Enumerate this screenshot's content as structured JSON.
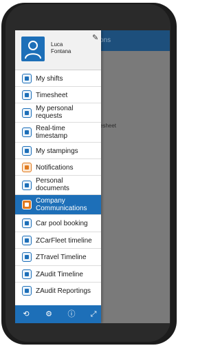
{
  "background_app": {
    "header_text_fragment": "ons",
    "body_text_fragment": "esheet"
  },
  "profile": {
    "first_name": "Luca",
    "last_name": "Fontana",
    "edit_icon": "pencil-icon"
  },
  "menu": {
    "items": [
      {
        "label": "My shifts",
        "icon": "shifts-icon",
        "active": false
      },
      {
        "label": "Timesheet",
        "icon": "gear-icon",
        "active": false
      },
      {
        "label": "My personal requests",
        "icon": "requests-icon",
        "active": false
      },
      {
        "label": "Real-time timestamp",
        "icon": "clock-icon",
        "active": false
      },
      {
        "label": "My stampings",
        "icon": "clock-icon",
        "active": false
      },
      {
        "label": "Notifications",
        "icon": "bell-icon",
        "active": false
      },
      {
        "label": "Personal documents",
        "icon": "document-icon",
        "active": false
      },
      {
        "label": "Company Communications",
        "icon": "communications-icon",
        "active": true
      },
      {
        "label": "Car pool booking",
        "icon": "car-icon",
        "active": false
      },
      {
        "label": "ZCarFleet timeline",
        "icon": "fleet-icon",
        "active": false
      },
      {
        "label": "ZTravel Timeline",
        "icon": "plane-icon",
        "active": false
      },
      {
        "label": "ZAudit Timeline",
        "icon": "check-icon",
        "active": false
      },
      {
        "label": "ZAudit Reportings",
        "icon": "check-icon",
        "active": false
      }
    ]
  },
  "footer_icons": [
    "logout-icon",
    "settings-icon",
    "info-icon",
    "expand-icon"
  ],
  "colors": {
    "primary_blue": "#1d6fb8",
    "header_dark_blue": "#1d4f7c",
    "accent_orange": "#e07a1f"
  }
}
